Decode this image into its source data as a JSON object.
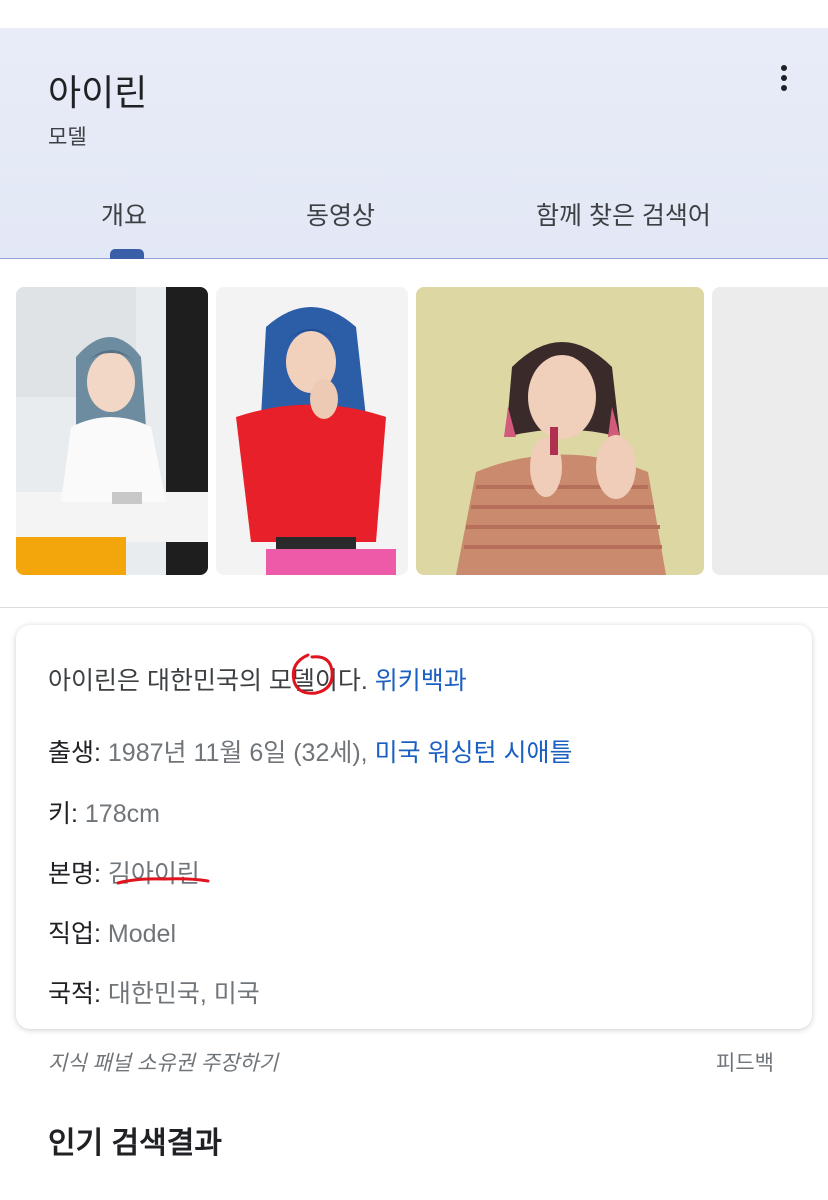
{
  "header": {
    "title": "아이린",
    "subtitle": "모델",
    "tabs": [
      {
        "label": "개요",
        "selected": true
      },
      {
        "label": "동영상",
        "selected": false
      },
      {
        "label": "함께 찾은 검색어",
        "selected": false
      }
    ],
    "more_icon": "more-vert-icon"
  },
  "images": [
    {
      "name": "photo-1"
    },
    {
      "name": "photo-2"
    },
    {
      "name": "photo-3"
    },
    {
      "name": "photo-4"
    }
  ],
  "card": {
    "description": "아이린은 대한민국의 모델이다.",
    "source_link": "위키백과",
    "facts": [
      {
        "label": "출생:",
        "value": "1987년 11월 6일 (32세),",
        "link": "미국 워싱턴 시애틀"
      },
      {
        "label": "키:",
        "value": "178cm"
      },
      {
        "label": "본명:",
        "value": "김아이린"
      },
      {
        "label": "직업:",
        "value": "Model"
      },
      {
        "label": "국적:",
        "value": "대한민국, 미국"
      }
    ]
  },
  "footer": {
    "claim": "지식 패널 소유권 주장하기",
    "feedback": "피드백"
  },
  "section_title": "인기 검색결과",
  "colors": {
    "header_bg": "#e6eaf7",
    "tab_indicator": "#3b5ea8",
    "link": "#1a5fc2",
    "annotation": "#e0141e"
  }
}
